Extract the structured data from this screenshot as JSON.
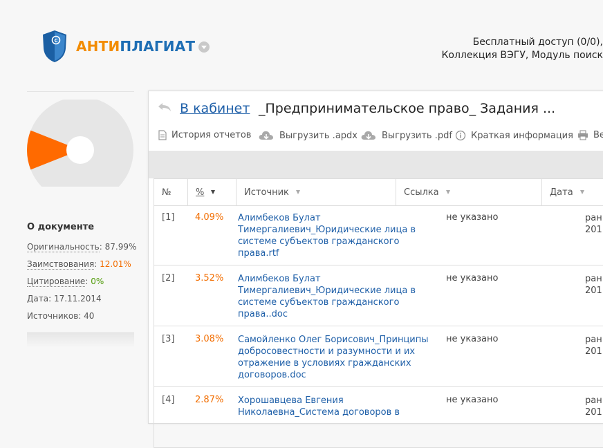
{
  "header": {
    "brand_part1": "АНТИ",
    "brand_part2": "ПЛАГИАТ",
    "access_line": "Бесплатный доступ (0/0),",
    "collection_line": "Коллекция ВЭГУ, Модуль поиск"
  },
  "about": {
    "title": "О документе",
    "originality_label": "Оригинальность",
    "originality_value": "87.99%",
    "borrowing_label": "Заимствования",
    "borrowing_value": "12.01%",
    "citation_label": "Цитирование",
    "citation_value": "0%",
    "date_label": "Дата",
    "date_value": "17.11.2014",
    "sources_label": "Источников",
    "sources_value": "40"
  },
  "pie": {
    "originality": 87.99,
    "borrowing": 12.01,
    "citation": 0,
    "colors": {
      "originality": "#e6e6e6",
      "borrowing": "#ff6a00"
    }
  },
  "panel": {
    "back_link": "В кабинет",
    "doc_title": "_Предпринимательское право_ Задания ..."
  },
  "toolbar": {
    "history": "История отчетов",
    "export_apdx": "Выгрузить .apdx",
    "export_pdf": "Выгрузить .pdf",
    "brief_info": "Краткая информация",
    "print": "Ве"
  },
  "table": {
    "headers": {
      "num": "№",
      "percent": "%",
      "source": "Источник",
      "link": "Ссылка",
      "date": "Дата"
    },
    "rows": [
      {
        "num": "[1]",
        "percent": "4.09%",
        "source": "Алимбеков Булат Тимергалиевич_Юридические лица в системе субъектов гражданского права.rtf",
        "link": "не указано",
        "date_line1": "ран",
        "date_line2": "201"
      },
      {
        "num": "[2]",
        "percent": "3.52%",
        "source": "Алимбеков Булат Тимергалиевич_Юридические лица в системе субъектов гражданского права..doc",
        "link": "не указано",
        "date_line1": "ран",
        "date_line2": "201"
      },
      {
        "num": "[3]",
        "percent": "3.08%",
        "source": "Самойленко Олег Борисович_Принципы добросовестности и разумности и их отражение в условиях гражданских договоров.doc",
        "link": "не указано",
        "date_line1": "ран",
        "date_line2": "201"
      },
      {
        "num": "[4]",
        "percent": "2.87%",
        "source": "Хорошавцева Евгения Николаевна_Система договоров в",
        "link": "не указано",
        "date_line1": "ран",
        "date_line2": "201"
      }
    ]
  }
}
